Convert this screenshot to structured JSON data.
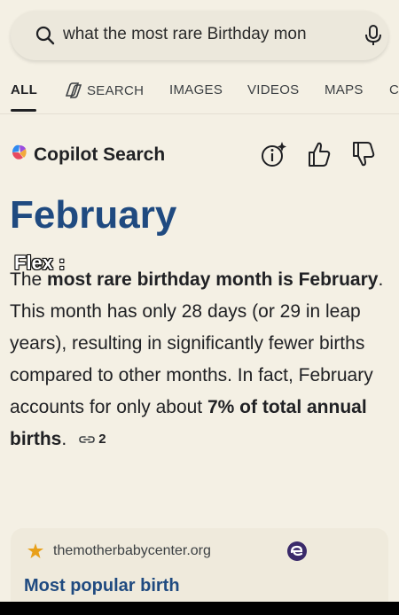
{
  "search": {
    "query": "what the most rare Birthday mon"
  },
  "tabs": [
    {
      "label": "ALL",
      "active": true
    },
    {
      "label": "SEARCH"
    },
    {
      "label": "IMAGES"
    },
    {
      "label": "VIDEOS"
    },
    {
      "label": "MAPS"
    },
    {
      "label": "C"
    }
  ],
  "copilot": {
    "title": "Copilot Search"
  },
  "answer": {
    "title": "February",
    "overlay_label": "Flex :",
    "p1": "The ",
    "p2": "most rare birthday month is February",
    "p3": ". This month has only 28 days (or 29 in leap years), resulting in significantly fewer births compared to other months. In fact, February accounts for only about ",
    "p4": "7% of total annual births",
    "p5": ".",
    "citation_count": "2"
  },
  "source": {
    "domain": "themotherbabycenter.org",
    "title": "Most popular birth"
  },
  "colors": {
    "accent_blue": "#1f4a80",
    "background": "#f4f0e4"
  }
}
